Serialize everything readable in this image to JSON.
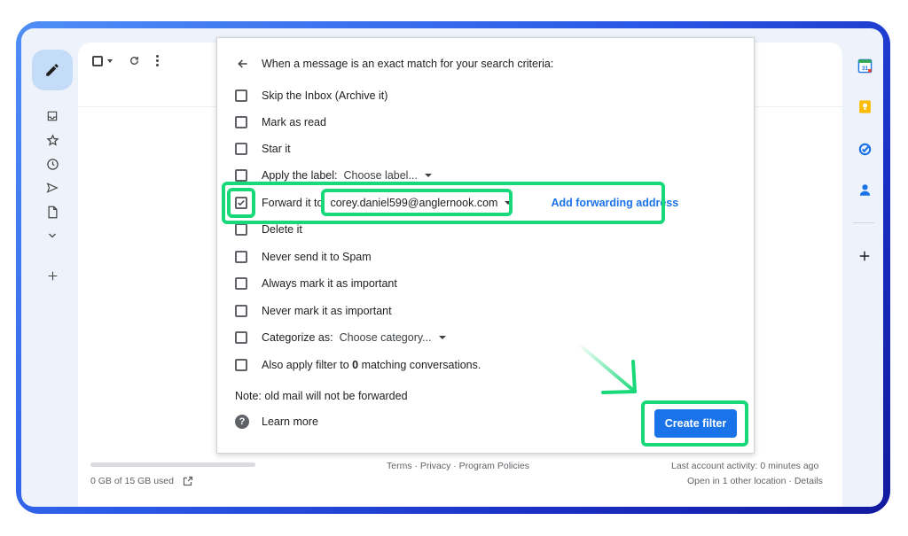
{
  "toolbar": {
    "checkbox": "select-all",
    "refresh": "refresh",
    "more": "more"
  },
  "left_rail": [
    "inbox-icon",
    "star-icon",
    "clock-icon",
    "send-icon",
    "file-icon",
    "chevron-down-icon",
    "plus-icon"
  ],
  "right_rail": {
    "calendar_day": "31",
    "items": [
      "calendar-icon",
      "keep-icon",
      "tasks-icon",
      "contacts-icon",
      "plus-icon"
    ]
  },
  "dialog": {
    "heading": "When a message is an exact match for your search criteria:",
    "options": {
      "skip_inbox": "Skip the Inbox (Archive it)",
      "mark_read": "Mark as read",
      "star": "Star it",
      "apply_label": "Apply the label:",
      "apply_label_select": "Choose label...",
      "forward": "Forward it to",
      "forward_address": "corey.daniel599@anglernook.com",
      "add_forwarding": "Add forwarding address",
      "delete": "Delete it",
      "never_spam": "Never send it to Spam",
      "always_important": "Always mark it as important",
      "never_important": "Never mark it as important",
      "categorize": "Categorize as:",
      "categorize_select": "Choose category...",
      "also_apply_pre": "Also apply filter to ",
      "also_apply_count": "0",
      "also_apply_post": " matching conversations."
    },
    "forward_checked": true,
    "note": "Note: old mail will not be forwarded",
    "learn_more": "Learn more",
    "help_glyph": "?",
    "create_filter": "Create filter"
  },
  "footer": {
    "storage": "0 GB of 15 GB used",
    "links": "Terms · Privacy · Program Policies",
    "activity": "Last account activity: 0 minutes ago",
    "other_location": "Open in 1 other location · Details"
  },
  "colors": {
    "accent": "#1a73e8",
    "highlight": "#18d97a",
    "frame": "#2a58e6"
  }
}
